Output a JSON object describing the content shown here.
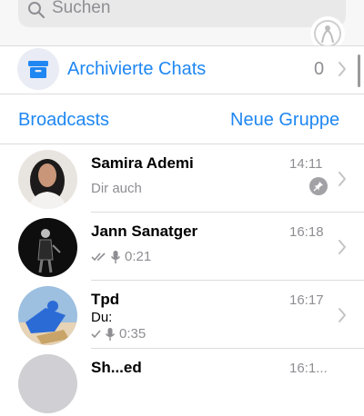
{
  "search": {
    "placeholder": "Suchen"
  },
  "archived": {
    "label": "Archivierte Chats",
    "count": "0"
  },
  "actions": {
    "broadcasts": "Broadcasts",
    "new_group": "Neue Gruppe"
  },
  "chats": [
    {
      "name": "Samira Ademi",
      "time": "14:11",
      "preview": "Dir auch",
      "pinned": true
    },
    {
      "name": "Jann Sanatger",
      "time": "16:18",
      "preview": "0:21",
      "ticks": "double",
      "voice": true
    },
    {
      "name": "Tpd",
      "time": "16:17",
      "sender": "Du:",
      "preview": "0:35",
      "ticks": "single",
      "voice": true
    },
    {
      "name": "Sh...ed",
      "time": "16:1..."
    }
  ],
  "colors": {
    "accent": "#1f87f2",
    "secondary": "#8e8e93"
  }
}
